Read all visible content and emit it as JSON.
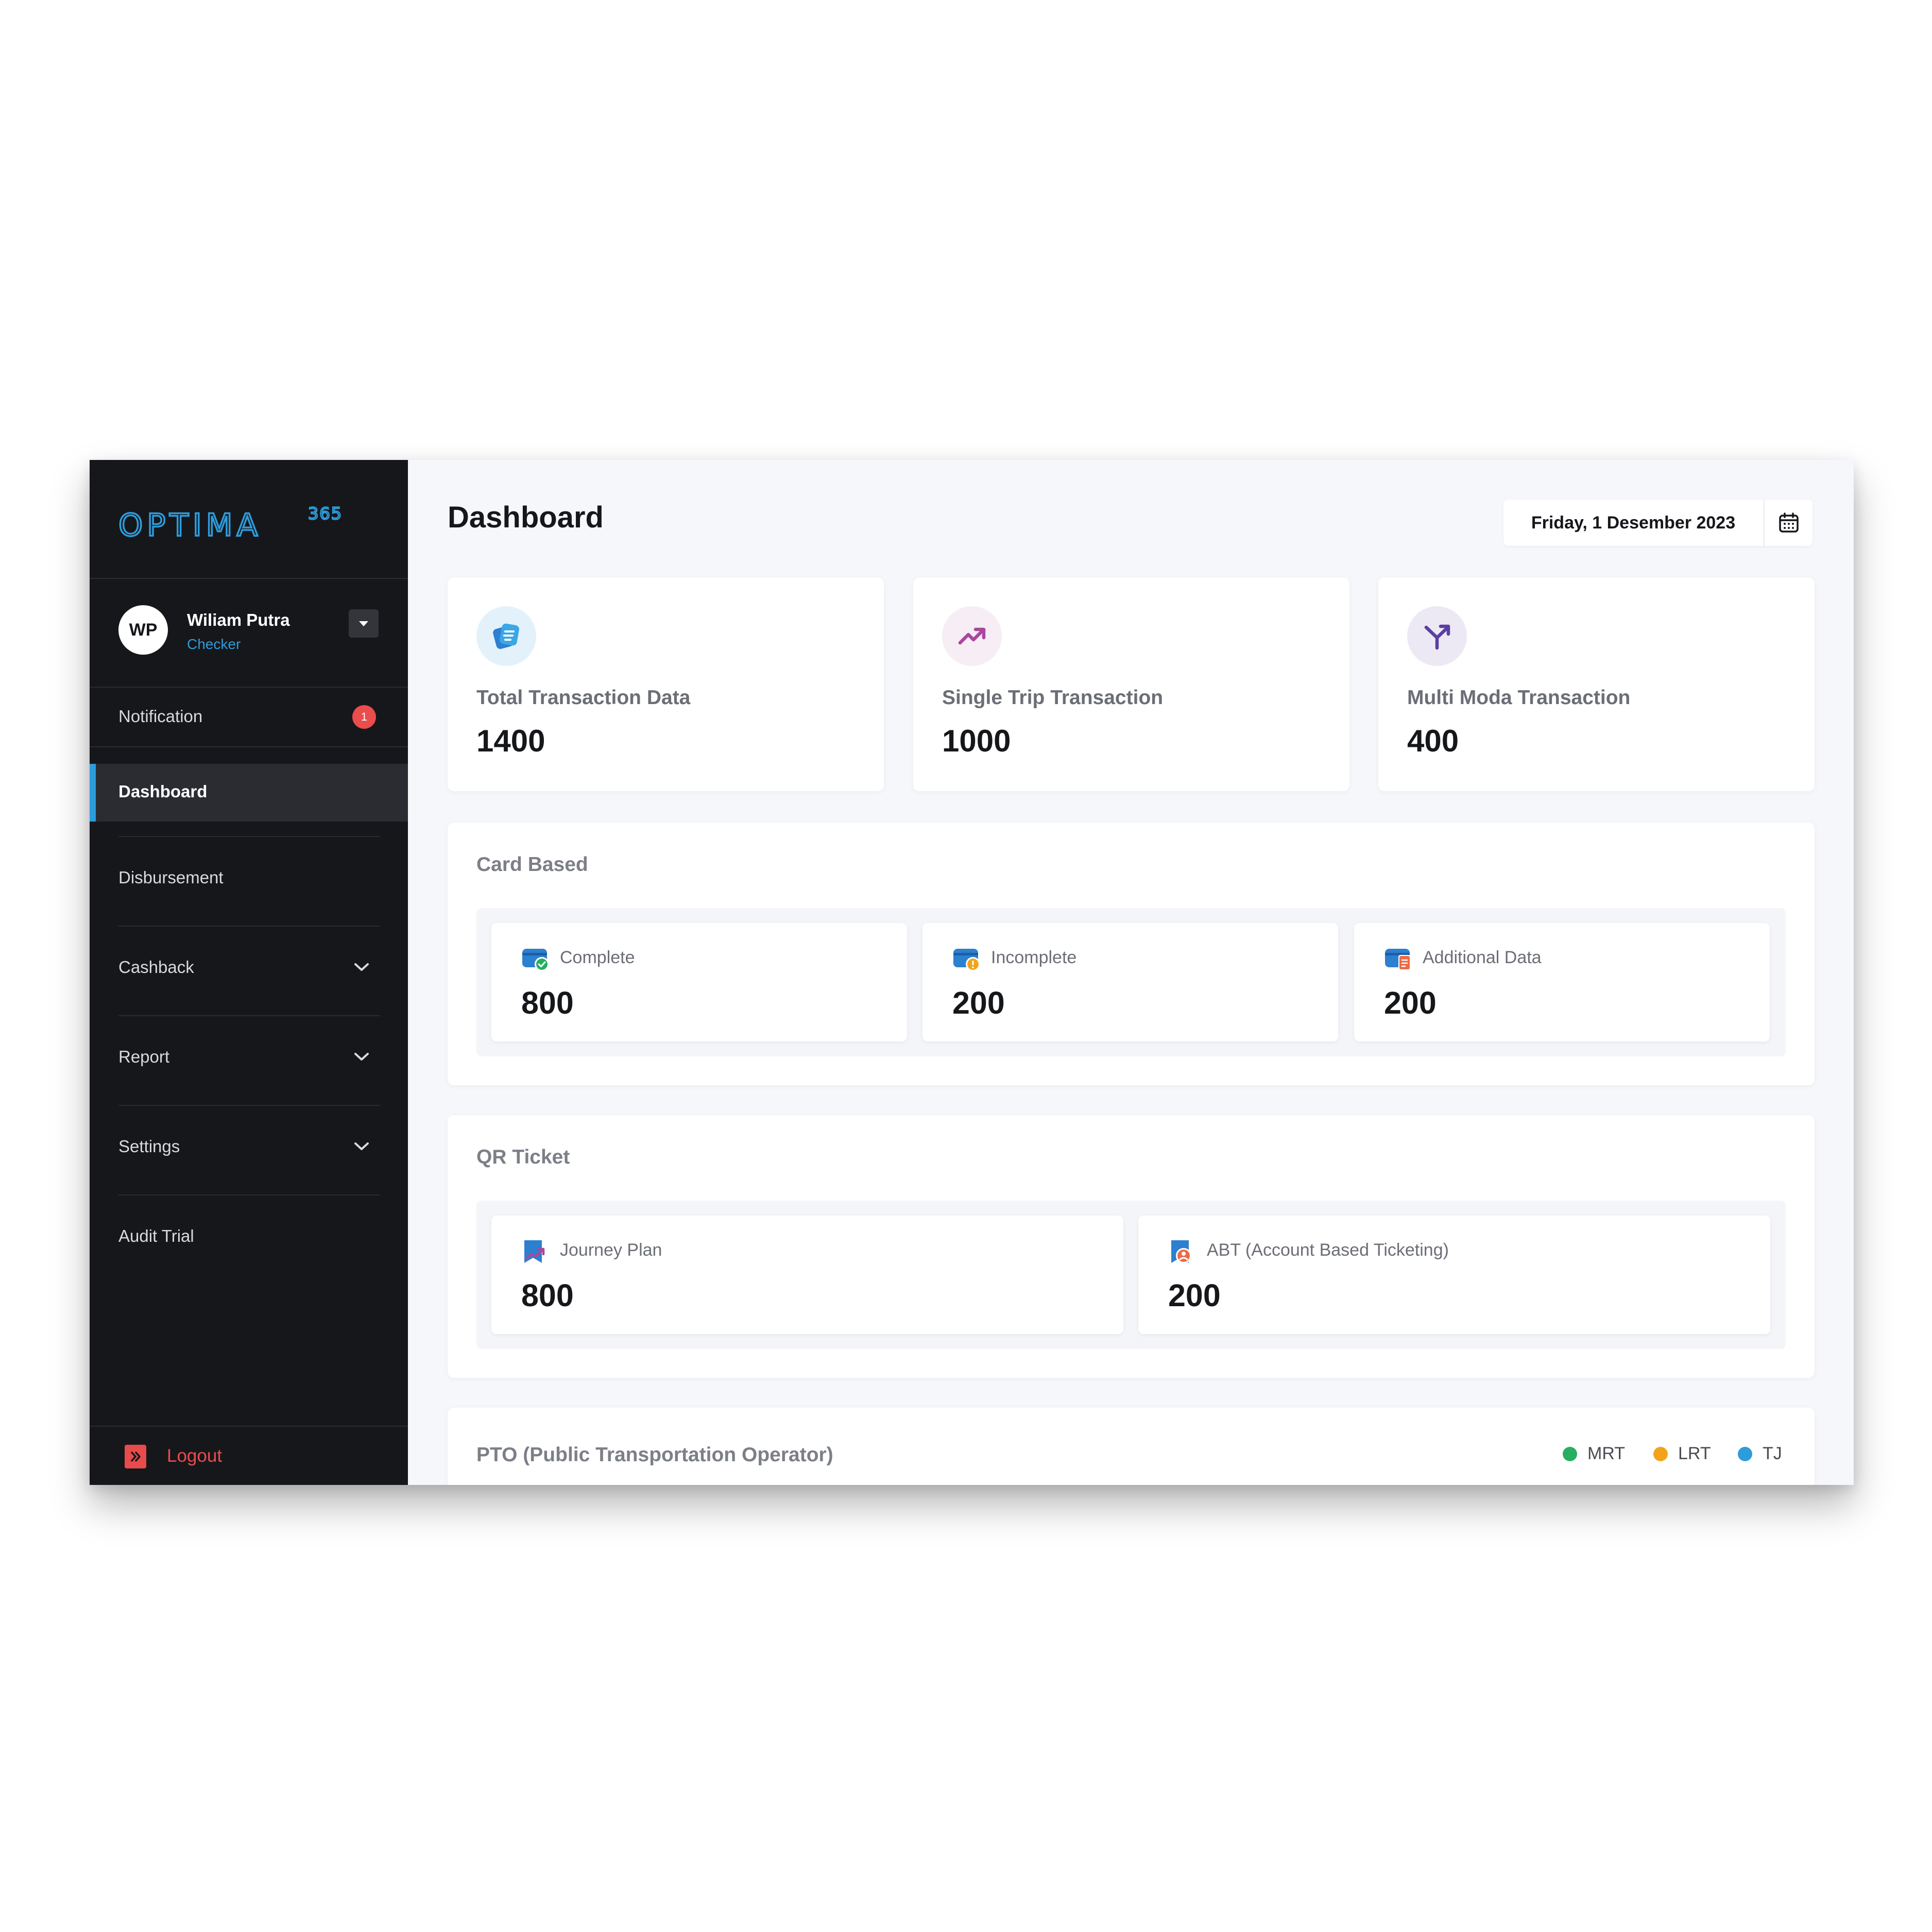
{
  "brand": {
    "name": "OPTIMA",
    "superscript": "365"
  },
  "user": {
    "initials": "WP",
    "name": "Wiliam Putra",
    "role": "Checker"
  },
  "nav": {
    "notification": {
      "label": "Notification",
      "count": "1"
    },
    "dashboard": "Dashboard",
    "disbursement": "Disbursement",
    "cashback": "Cashback",
    "report": "Report",
    "settings": "Settings",
    "audit": "Audit Trial",
    "logout": "Logout"
  },
  "header": {
    "title": "Dashboard",
    "date": "Friday, 1 Desember 2023"
  },
  "stats": [
    {
      "label": "Total Transaction Data",
      "value": "1400"
    },
    {
      "label": "Single Trip Transaction",
      "value": "1000"
    },
    {
      "label": "Multi Moda Transaction",
      "value": "400"
    }
  ],
  "card_based": {
    "title": "Card Based",
    "items": [
      {
        "label": "Complete",
        "value": "800"
      },
      {
        "label": "Incomplete",
        "value": "200"
      },
      {
        "label": "Additional Data",
        "value": "200"
      }
    ]
  },
  "qr_ticket": {
    "title": "QR Ticket",
    "items": [
      {
        "label": "Journey Plan",
        "value": "800"
      },
      {
        "label": "ABT (Account Based Ticketing)",
        "value": "200"
      }
    ]
  },
  "pto": {
    "title": "PTO (Public Transportation Operator)",
    "legend": [
      {
        "label": "MRT",
        "color": "#27ae60"
      },
      {
        "label": "LRT",
        "color": "#f2a31b"
      },
      {
        "label": "TJ",
        "color": "#2d9cdb"
      }
    ]
  },
  "colors": {
    "accent": "#2d9cdb",
    "danger": "#eb4c4c",
    "sidebar": "#16171b"
  }
}
